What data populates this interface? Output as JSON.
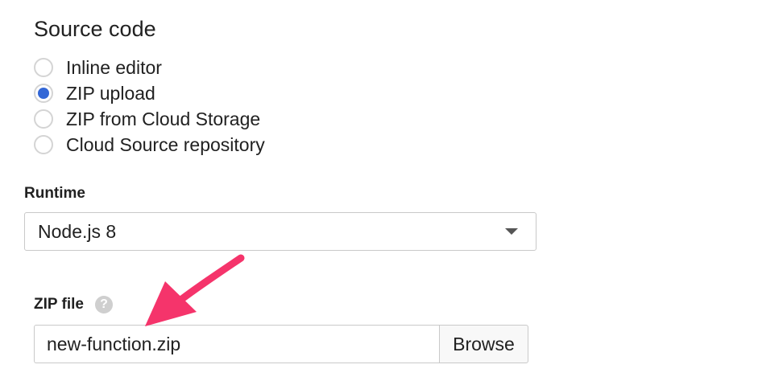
{
  "source_code": {
    "title": "Source code",
    "options": [
      {
        "label": "Inline editor",
        "checked": false
      },
      {
        "label": "ZIP upload",
        "checked": true
      },
      {
        "label": "ZIP from Cloud Storage",
        "checked": false
      },
      {
        "label": "Cloud Source repository",
        "checked": false
      }
    ]
  },
  "runtime": {
    "label": "Runtime",
    "selected": "Node.js 8"
  },
  "zip_file": {
    "label": "ZIP file",
    "help_icon": "?",
    "value": "new-function.zip",
    "browse_label": "Browse"
  },
  "annotation": {
    "icon": "arrow-icon",
    "color": "#f5346b"
  },
  "colors": {
    "accent": "#3367d6",
    "border": "#c9c9c9"
  }
}
